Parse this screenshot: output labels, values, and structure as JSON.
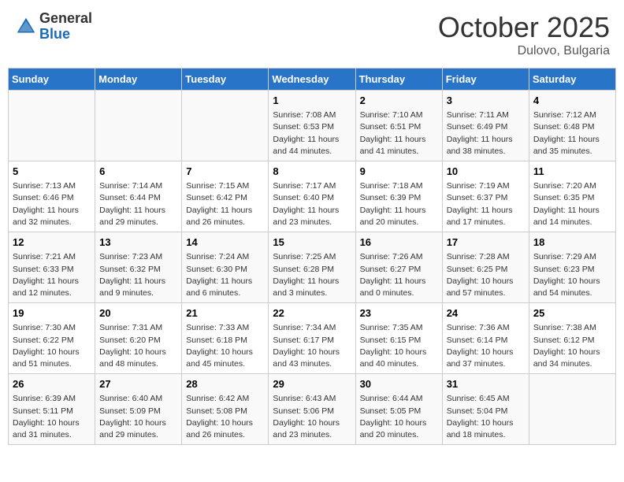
{
  "header": {
    "logo_general": "General",
    "logo_blue": "Blue",
    "month_title": "October 2025",
    "location": "Dulovo, Bulgaria"
  },
  "days_of_week": [
    "Sunday",
    "Monday",
    "Tuesday",
    "Wednesday",
    "Thursday",
    "Friday",
    "Saturday"
  ],
  "weeks": [
    [
      {
        "day": "",
        "sunrise": "",
        "sunset": "",
        "daylight": ""
      },
      {
        "day": "",
        "sunrise": "",
        "sunset": "",
        "daylight": ""
      },
      {
        "day": "",
        "sunrise": "",
        "sunset": "",
        "daylight": ""
      },
      {
        "day": "1",
        "sunrise": "Sunrise: 7:08 AM",
        "sunset": "Sunset: 6:53 PM",
        "daylight": "Daylight: 11 hours and 44 minutes."
      },
      {
        "day": "2",
        "sunrise": "Sunrise: 7:10 AM",
        "sunset": "Sunset: 6:51 PM",
        "daylight": "Daylight: 11 hours and 41 minutes."
      },
      {
        "day": "3",
        "sunrise": "Sunrise: 7:11 AM",
        "sunset": "Sunset: 6:49 PM",
        "daylight": "Daylight: 11 hours and 38 minutes."
      },
      {
        "day": "4",
        "sunrise": "Sunrise: 7:12 AM",
        "sunset": "Sunset: 6:48 PM",
        "daylight": "Daylight: 11 hours and 35 minutes."
      }
    ],
    [
      {
        "day": "5",
        "sunrise": "Sunrise: 7:13 AM",
        "sunset": "Sunset: 6:46 PM",
        "daylight": "Daylight: 11 hours and 32 minutes."
      },
      {
        "day": "6",
        "sunrise": "Sunrise: 7:14 AM",
        "sunset": "Sunset: 6:44 PM",
        "daylight": "Daylight: 11 hours and 29 minutes."
      },
      {
        "day": "7",
        "sunrise": "Sunrise: 7:15 AM",
        "sunset": "Sunset: 6:42 PM",
        "daylight": "Daylight: 11 hours and 26 minutes."
      },
      {
        "day": "8",
        "sunrise": "Sunrise: 7:17 AM",
        "sunset": "Sunset: 6:40 PM",
        "daylight": "Daylight: 11 hours and 23 minutes."
      },
      {
        "day": "9",
        "sunrise": "Sunrise: 7:18 AM",
        "sunset": "Sunset: 6:39 PM",
        "daylight": "Daylight: 11 hours and 20 minutes."
      },
      {
        "day": "10",
        "sunrise": "Sunrise: 7:19 AM",
        "sunset": "Sunset: 6:37 PM",
        "daylight": "Daylight: 11 hours and 17 minutes."
      },
      {
        "day": "11",
        "sunrise": "Sunrise: 7:20 AM",
        "sunset": "Sunset: 6:35 PM",
        "daylight": "Daylight: 11 hours and 14 minutes."
      }
    ],
    [
      {
        "day": "12",
        "sunrise": "Sunrise: 7:21 AM",
        "sunset": "Sunset: 6:33 PM",
        "daylight": "Daylight: 11 hours and 12 minutes."
      },
      {
        "day": "13",
        "sunrise": "Sunrise: 7:23 AM",
        "sunset": "Sunset: 6:32 PM",
        "daylight": "Daylight: 11 hours and 9 minutes."
      },
      {
        "day": "14",
        "sunrise": "Sunrise: 7:24 AM",
        "sunset": "Sunset: 6:30 PM",
        "daylight": "Daylight: 11 hours and 6 minutes."
      },
      {
        "day": "15",
        "sunrise": "Sunrise: 7:25 AM",
        "sunset": "Sunset: 6:28 PM",
        "daylight": "Daylight: 11 hours and 3 minutes."
      },
      {
        "day": "16",
        "sunrise": "Sunrise: 7:26 AM",
        "sunset": "Sunset: 6:27 PM",
        "daylight": "Daylight: 11 hours and 0 minutes."
      },
      {
        "day": "17",
        "sunrise": "Sunrise: 7:28 AM",
        "sunset": "Sunset: 6:25 PM",
        "daylight": "Daylight: 10 hours and 57 minutes."
      },
      {
        "day": "18",
        "sunrise": "Sunrise: 7:29 AM",
        "sunset": "Sunset: 6:23 PM",
        "daylight": "Daylight: 10 hours and 54 minutes."
      }
    ],
    [
      {
        "day": "19",
        "sunrise": "Sunrise: 7:30 AM",
        "sunset": "Sunset: 6:22 PM",
        "daylight": "Daylight: 10 hours and 51 minutes."
      },
      {
        "day": "20",
        "sunrise": "Sunrise: 7:31 AM",
        "sunset": "Sunset: 6:20 PM",
        "daylight": "Daylight: 10 hours and 48 minutes."
      },
      {
        "day": "21",
        "sunrise": "Sunrise: 7:33 AM",
        "sunset": "Sunset: 6:18 PM",
        "daylight": "Daylight: 10 hours and 45 minutes."
      },
      {
        "day": "22",
        "sunrise": "Sunrise: 7:34 AM",
        "sunset": "Sunset: 6:17 PM",
        "daylight": "Daylight: 10 hours and 43 minutes."
      },
      {
        "day": "23",
        "sunrise": "Sunrise: 7:35 AM",
        "sunset": "Sunset: 6:15 PM",
        "daylight": "Daylight: 10 hours and 40 minutes."
      },
      {
        "day": "24",
        "sunrise": "Sunrise: 7:36 AM",
        "sunset": "Sunset: 6:14 PM",
        "daylight": "Daylight: 10 hours and 37 minutes."
      },
      {
        "day": "25",
        "sunrise": "Sunrise: 7:38 AM",
        "sunset": "Sunset: 6:12 PM",
        "daylight": "Daylight: 10 hours and 34 minutes."
      }
    ],
    [
      {
        "day": "26",
        "sunrise": "Sunrise: 6:39 AM",
        "sunset": "Sunset: 5:11 PM",
        "daylight": "Daylight: 10 hours and 31 minutes."
      },
      {
        "day": "27",
        "sunrise": "Sunrise: 6:40 AM",
        "sunset": "Sunset: 5:09 PM",
        "daylight": "Daylight: 10 hours and 29 minutes."
      },
      {
        "day": "28",
        "sunrise": "Sunrise: 6:42 AM",
        "sunset": "Sunset: 5:08 PM",
        "daylight": "Daylight: 10 hours and 26 minutes."
      },
      {
        "day": "29",
        "sunrise": "Sunrise: 6:43 AM",
        "sunset": "Sunset: 5:06 PM",
        "daylight": "Daylight: 10 hours and 23 minutes."
      },
      {
        "day": "30",
        "sunrise": "Sunrise: 6:44 AM",
        "sunset": "Sunset: 5:05 PM",
        "daylight": "Daylight: 10 hours and 20 minutes."
      },
      {
        "day": "31",
        "sunrise": "Sunrise: 6:45 AM",
        "sunset": "Sunset: 5:04 PM",
        "daylight": "Daylight: 10 hours and 18 minutes."
      },
      {
        "day": "",
        "sunrise": "",
        "sunset": "",
        "daylight": ""
      }
    ]
  ]
}
